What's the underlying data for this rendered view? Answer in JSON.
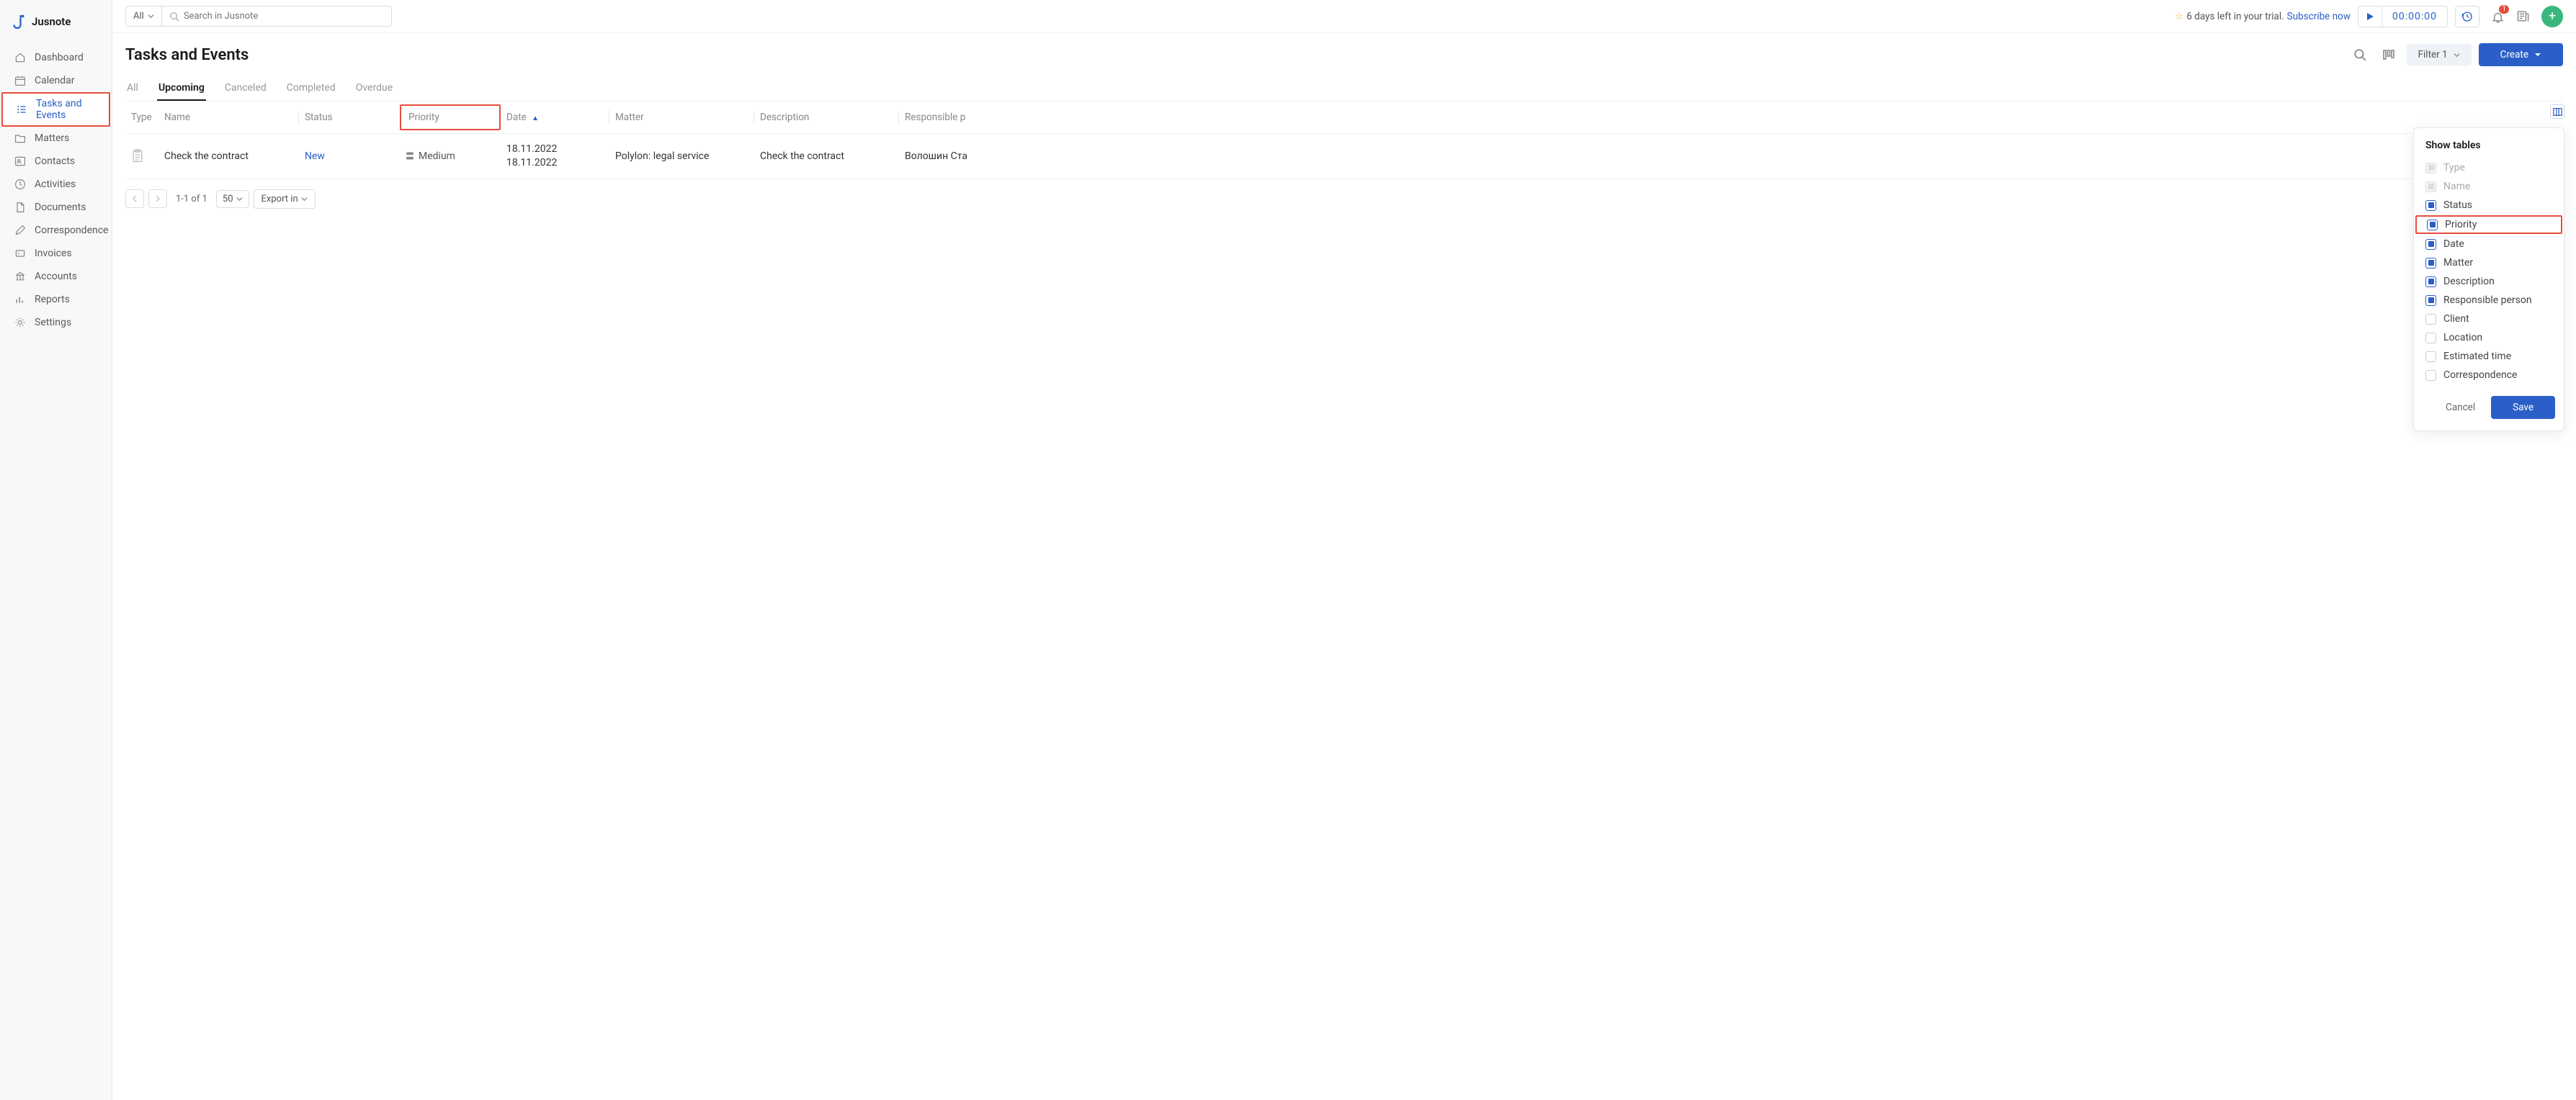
{
  "app_name": "Jusnote",
  "sidebar": {
    "items": [
      {
        "label": "Dashboard",
        "icon": "home"
      },
      {
        "label": "Calendar",
        "icon": "calendar"
      },
      {
        "label": "Tasks and Events",
        "icon": "tasks",
        "active": true
      },
      {
        "label": "Matters",
        "icon": "folder"
      },
      {
        "label": "Contacts",
        "icon": "contact"
      },
      {
        "label": "Activities",
        "icon": "activity"
      },
      {
        "label": "Documents",
        "icon": "doc"
      },
      {
        "label": "Correspondence",
        "icon": "pencil"
      },
      {
        "label": "Invoices",
        "icon": "invoice"
      },
      {
        "label": "Accounts",
        "icon": "bank"
      },
      {
        "label": "Reports",
        "icon": "chart"
      },
      {
        "label": "Settings",
        "icon": "gear"
      }
    ]
  },
  "topbar": {
    "search_scope": "All",
    "search_placeholder": "Search in Jusnote",
    "trial_text": "6 days left in your trial.",
    "subscribe": "Subscribe now",
    "timer": "00:00:00",
    "notif_badge": "1",
    "avatar_label": "+"
  },
  "page": {
    "title": "Tasks and Events",
    "tabs": [
      "All",
      "Upcoming",
      "Canceled",
      "Completed",
      "Overdue"
    ],
    "active_tab": "Upcoming",
    "filter_label": "Filter 1",
    "create_label": "Create"
  },
  "columns": {
    "type": "Type",
    "name": "Name",
    "status": "Status",
    "priority": "Priority",
    "date": "Date",
    "matter": "Matter",
    "description": "Description",
    "responsible": "Responsible p"
  },
  "rows": [
    {
      "name": "Check the contract",
      "status": "New",
      "priority": "Medium",
      "date1": "18.11.2022",
      "date2": "18.11.2022",
      "matter": "Polylon: legal service",
      "description": "Check the contract",
      "responsible": "Волошин Ста"
    }
  ],
  "pagination": {
    "range": "1-1 of 1",
    "page_size": "50",
    "export": "Export in"
  },
  "popover": {
    "title": "Show tables",
    "items": [
      {
        "label": "Type",
        "state": "disabled"
      },
      {
        "label": "Name",
        "state": "disabled"
      },
      {
        "label": "Status",
        "state": "checked"
      },
      {
        "label": "Priority",
        "state": "checked",
        "highlight": true
      },
      {
        "label": "Date",
        "state": "checked"
      },
      {
        "label": "Matter",
        "state": "checked"
      },
      {
        "label": "Description",
        "state": "checked"
      },
      {
        "label": "Responsible person",
        "state": "checked"
      },
      {
        "label": "Client",
        "state": "unchecked"
      },
      {
        "label": "Location",
        "state": "unchecked"
      },
      {
        "label": "Estimated time",
        "state": "unchecked"
      },
      {
        "label": "Correspondence",
        "state": "unchecked"
      }
    ],
    "cancel": "Cancel",
    "save": "Save"
  }
}
